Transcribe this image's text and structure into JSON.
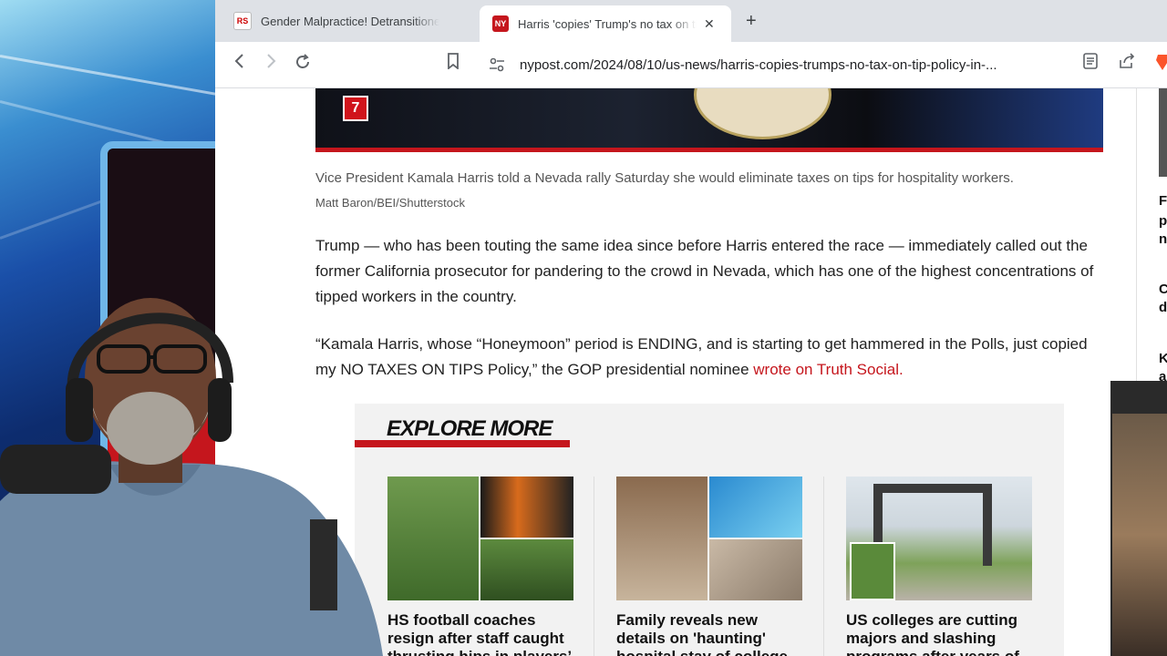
{
  "browser": {
    "tabs": [
      {
        "title": "Gender Malpractice! Detransitioners",
        "favicon": "RS"
      },
      {
        "title": "Harris 'copies' Trump's no tax on tips",
        "favicon": "NY",
        "active": true
      }
    ],
    "new_tab_symbol": "+",
    "close_symbol": "✕",
    "url": "nypost.com/2024/08/10/us-news/harris-copies-trumps-no-tax-on-tip-policy-in-..."
  },
  "article": {
    "photo_badge": "7",
    "caption": "Vice President Kamala Harris told a Nevada rally Saturday she would eliminate taxes on tips for hospitality workers.",
    "credit": "Matt Baron/BEI/Shutterstock",
    "paragraph1": "Trump — who has been touting the same idea since before Harris entered the race — immediately called out the former California prosecutor for pandering to the crowd in Nevada, which has one of the highest concentrations of tipped workers in the country.",
    "paragraph2_text": "“Kamala Harris, whose “Honeymoon” period is ENDING, and is starting to get hammered in the Polls, just copied my NO TAXES ON TIPS Policy,” the GOP presidential nominee ",
    "paragraph2_link": "wrote on Truth Social."
  },
  "explore": {
    "heading": "EXPLORE MORE",
    "cards": [
      {
        "title": "HS football coaches resign after staff caught thrusting hips in players’"
      },
      {
        "title": "Family reveals new details on 'haunting' hospital stay of college"
      },
      {
        "title": "US colleges are cutting majors and slashing programs after years of"
      }
    ]
  },
  "sidebar_peek": [
    "F",
    "p",
    "n",
    "C",
    "d",
    "K",
    "a"
  ],
  "colors": {
    "brand_red": "#c5161d",
    "link": "#c5161d"
  }
}
